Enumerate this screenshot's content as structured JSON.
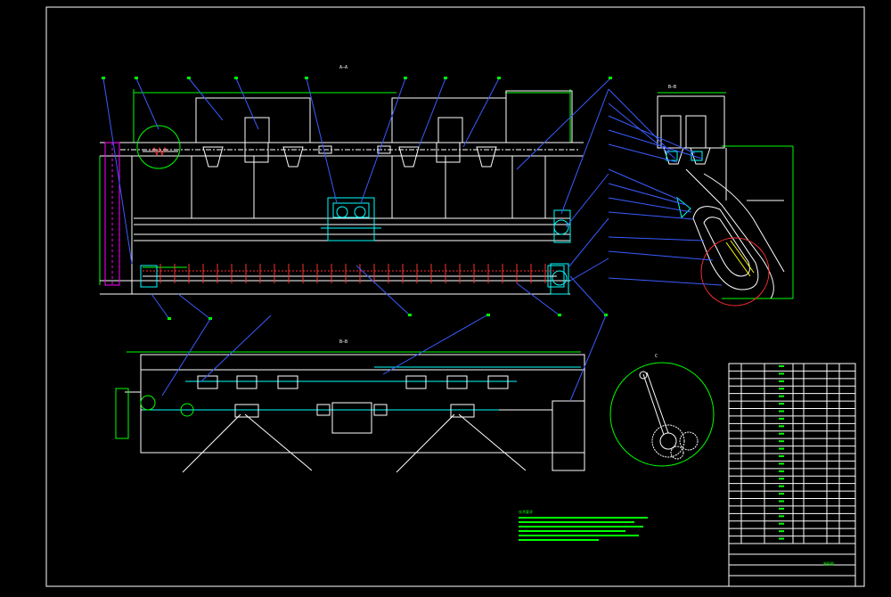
{
  "drawing": {
    "background_color": "#000000",
    "line_colors": {
      "frame": "#ffffff",
      "outline": "#ffffff",
      "leader": "#3a5cff",
      "dimension": "#00ff00",
      "section": "#00ffff",
      "teeth": "#ff3030",
      "notes": "#00ff00",
      "yellow": "#ffff00",
      "magenta": "#ff00ff"
    },
    "views": [
      {
        "id": "top-view",
        "label": "A—A"
      },
      {
        "id": "front-view",
        "label": "B—B"
      },
      {
        "id": "side-view",
        "label": "B—B"
      },
      {
        "id": "detail-view",
        "label": "C"
      }
    ],
    "title_block": {
      "rows": 24,
      "bottom_label": "装配图"
    },
    "notes": {
      "heading": "技术要求",
      "line_count": 6
    }
  }
}
